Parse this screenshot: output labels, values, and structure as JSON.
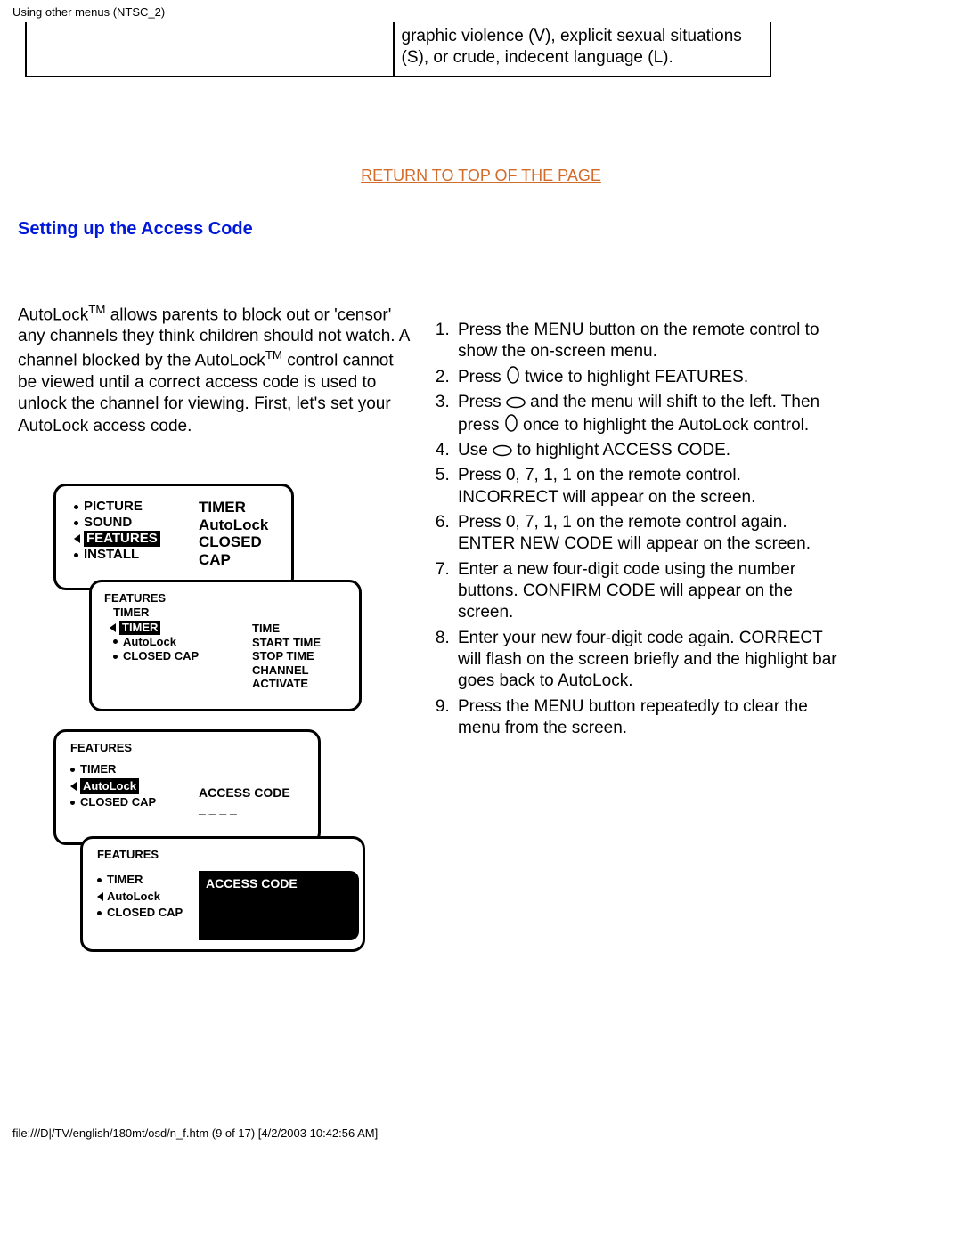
{
  "header": "Using other menus (NTSC_2)",
  "top_text": "graphic violence (V), explicit sexual situations (S), or crude, indecent language (L).",
  "return_link": "RETURN TO TOP OF THE PAGE",
  "section_title": "Setting up the Access Code",
  "intro": {
    "p1a": "AutoLock",
    "p1b": " allows parents to block out or 'censor' any channels they think children should not watch. A channel blocked by the AutoLock",
    "p1c": " control cannot be viewed until a correct access code is used to unlock the channel for viewing. First, let's set your AutoLock access code."
  },
  "steps": {
    "s1": "Press the MENU button on the remote control to show the on-screen menu.",
    "s2a": "Press ",
    "s2b": " twice to highlight FEATURES.",
    "s3a": "Press ",
    "s3b": " and the menu will shift to the left. Then press ",
    "s3c": " once to highlight the AutoLock control.",
    "s4a": "Use ",
    "s4b": " to highlight ACCESS CODE.",
    "s5": "Press 0, 7, 1, 1 on the remote control. INCORRECT will appear on the screen.",
    "s6": "Press 0, 7, 1, 1 on the remote control again. ENTER NEW CODE will appear on the screen.",
    "s7": "Enter a new four-digit code using the number buttons. CONFIRM CODE will appear on the screen.",
    "s8": "Enter your new four-digit code again. CORRECT will flash on the screen briefly and the highlight bar goes back to AutoLock.",
    "s9": "Press the MENU button repeatedly to clear the menu from the screen."
  },
  "osd": {
    "picture": "PICTURE",
    "sound": "SOUND",
    "features": "FEATURES",
    "install": "INSTALL",
    "timer": "TIMER",
    "autolock": "AutoLock",
    "closed_cap": "CLOSED CAP",
    "time": "TIME",
    "start_time": "START TIME",
    "stop_time": "STOP TIME",
    "channel": "CHANNEL",
    "activate": "ACTIVATE",
    "access_code": "ACCESS CODE",
    "dashes": "_ _ _ _"
  },
  "footer": "file:///D|/TV/english/180mt/osd/n_f.htm (9 of 17) [4/2/2003 10:42:56 AM]"
}
